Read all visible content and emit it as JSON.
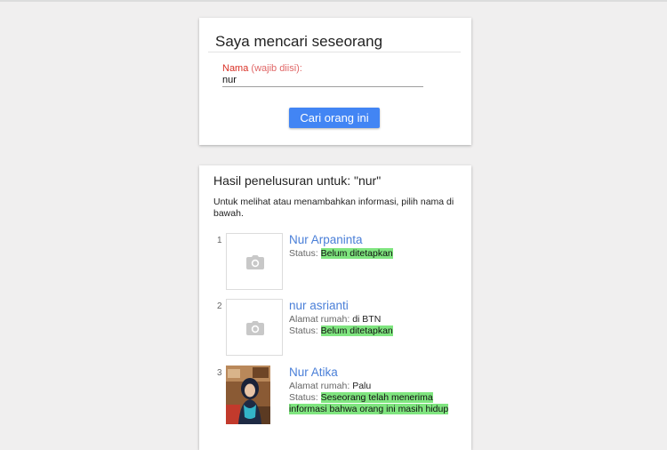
{
  "search": {
    "title": "Saya mencari seseorang",
    "field_label": "Nama",
    "field_hint": "(wajib diisi):",
    "name_value": "nur",
    "button_label": "Cari orang ini"
  },
  "results": {
    "title": "Hasil penelusuran untuk: \"nur\"",
    "help_text": "Untuk melihat atau menambahkan informasi, pilih nama di bawah.",
    "address_label": "Alamat rumah:",
    "status_label": "Status:",
    "items": [
      {
        "number": "1",
        "name": "Nur Arpaninta",
        "address": null,
        "status": "Belum ditetapkan",
        "photo": "camera-placeholder"
      },
      {
        "number": "2",
        "name": "nur asrianti",
        "address": "di BTN",
        "status": "Belum ditetapkan",
        "photo": "camera-placeholder"
      },
      {
        "number": "3",
        "name": "Nur Atika",
        "address": "Palu",
        "status": "Seseorang telah menerima informasi bahwa orang ini masih hidup",
        "photo": "person-photo"
      }
    ]
  },
  "colors": {
    "accent": "#4285f4",
    "link": "#4a7fd8",
    "required": "#d93025",
    "status_highlight": "#7fe57f"
  }
}
